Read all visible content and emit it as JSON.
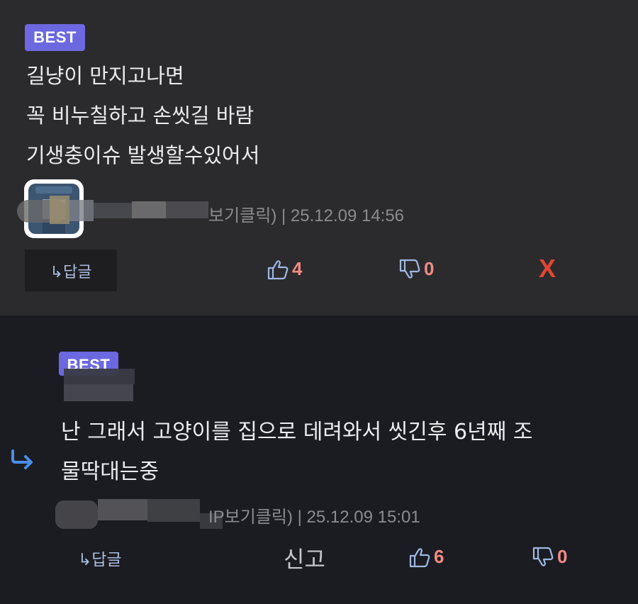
{
  "top_comment": {
    "badge": "BEST",
    "lines": [
      "길냥이 만지고나면",
      "꼭 비누칠하고 손씻길 바람",
      "기생충이슈 발생할수있어서"
    ],
    "meta": "보기클릭) | 25.12.09 14:56",
    "reply_label": "↳답글",
    "likes": "4",
    "dislikes": "0",
    "delete_label": "X"
  },
  "reply_comment": {
    "badge": "BEST",
    "lines": [
      "난 그래서 고양이를 집으로 데려와서 씻긴후 6년째 조",
      "물딱대는중"
    ],
    "meta": "IP보기클릭) | 25.12.09 15:01",
    "reply_label": "↳답글",
    "report_label": "신고",
    "likes": "6",
    "dislikes": "0"
  },
  "colors": {
    "badge": "#6b68e0",
    "count": "#ef8b84",
    "link": "#a9bde0",
    "delete": "#e2462f",
    "reply_arrow": "#4a8ee8"
  },
  "icons": [
    "thumbs-up-icon",
    "thumbs-down-icon",
    "reply-arrow-icon"
  ]
}
